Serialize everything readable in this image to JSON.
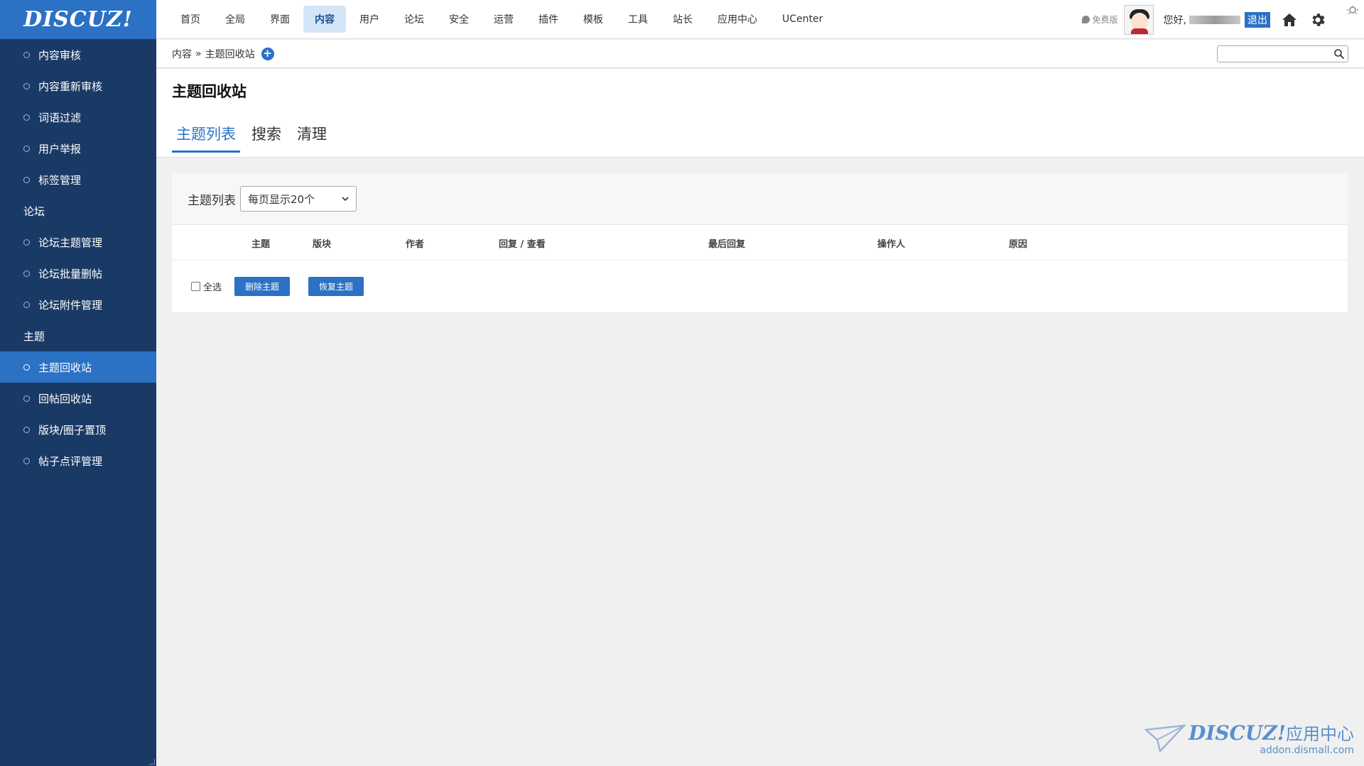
{
  "logo": "DISCUZ!",
  "sidebar": {
    "items": [
      {
        "label": "内容审核",
        "type": "item"
      },
      {
        "label": "内容重新审核",
        "type": "item"
      },
      {
        "label": "词语过滤",
        "type": "item"
      },
      {
        "label": "用户举报",
        "type": "item"
      },
      {
        "label": "标签管理",
        "type": "item"
      },
      {
        "label": "论坛",
        "type": "group"
      },
      {
        "label": "论坛主题管理",
        "type": "item"
      },
      {
        "label": "论坛批量删帖",
        "type": "item"
      },
      {
        "label": "论坛附件管理",
        "type": "item"
      },
      {
        "label": "主题",
        "type": "group"
      },
      {
        "label": "主题回收站",
        "type": "item",
        "active": true
      },
      {
        "label": "回帖回收站",
        "type": "item"
      },
      {
        "label": "版块/圈子置顶",
        "type": "item"
      },
      {
        "label": "帖子点评管理",
        "type": "item"
      }
    ]
  },
  "topnav": {
    "items": [
      "首页",
      "全局",
      "界面",
      "内容",
      "用户",
      "论坛",
      "安全",
      "运营",
      "插件",
      "模板",
      "工具",
      "站长",
      "应用中心",
      "UCenter"
    ],
    "active": "内容",
    "free_label": "免费版",
    "greeting": "您好,",
    "logout": "退出"
  },
  "breadcrumb": {
    "root": "内容",
    "sep": "»",
    "current": "主题回收站",
    "plus": "+"
  },
  "search": {
    "placeholder": "",
    "value": ""
  },
  "page": {
    "title": "主题回收站",
    "tabs": [
      {
        "label": "主题列表",
        "active": true
      },
      {
        "label": "搜索"
      },
      {
        "label": "清理"
      }
    ]
  },
  "list": {
    "label": "主题列表",
    "perpage": "每页显示20个",
    "columns": [
      "主题",
      "版块",
      "作者",
      "回复 / 查看",
      "最后回复",
      "操作人",
      "原因"
    ],
    "select_all": "全选",
    "delete_button": "删除主题",
    "restore_button": "恢复主题"
  },
  "watermark": {
    "brand": "DISCUZ!",
    "brand_cn": "应用中心",
    "url": "addon.dismall.com"
  },
  "colors": {
    "sidebar_bg": "#1a3a66",
    "accent": "#2b71c4",
    "nav_active_bg": "#d4e5f8"
  }
}
